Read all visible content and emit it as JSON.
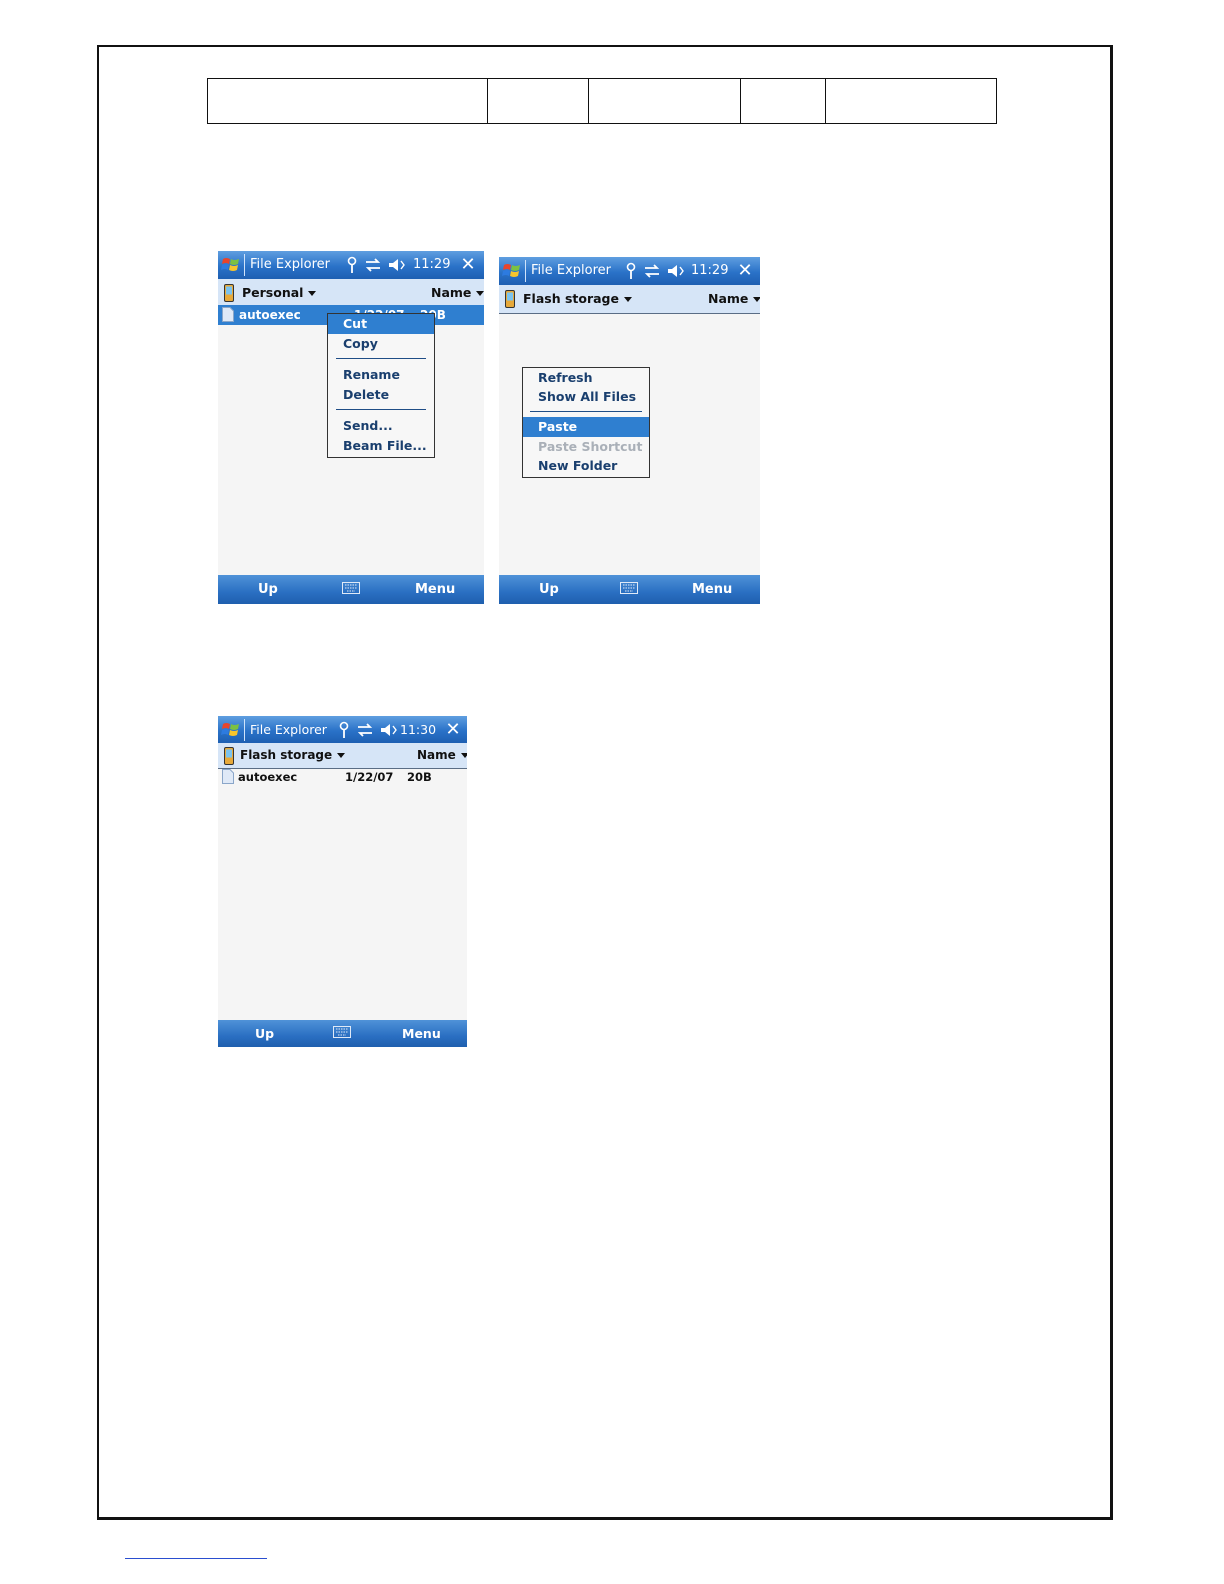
{
  "colors": {
    "titlebar": "#2a72c8",
    "pathbar": "#d6e5f7",
    "selection": "#2f7fd0",
    "menu_text": "#1a3f6e",
    "disabled_text": "#aab0b8"
  },
  "screens": [
    {
      "title": "File Explorer",
      "time": "11:29",
      "folder": "Personal",
      "sort": "Name",
      "file": {
        "name": "autoexec",
        "date": "1/22/07",
        "size": "20B",
        "selected": true
      },
      "context_menu": [
        "Cut",
        "Copy",
        "Rename",
        "Delete",
        "Send...",
        "Beam File..."
      ],
      "softkeys": {
        "left": "Up",
        "right": "Menu"
      }
    },
    {
      "title": "File Explorer",
      "time": "11:29",
      "folder": "Flash storage",
      "sort": "Name",
      "context_menu": [
        "Refresh",
        "Show All Files",
        "Paste",
        "Paste Shortcut",
        "New Folder"
      ],
      "softkeys": {
        "left": "Up",
        "right": "Menu"
      }
    },
    {
      "title": "File Explorer",
      "time": "11:30",
      "folder": "Flash storage",
      "sort": "Name",
      "file": {
        "name": "autoexec",
        "date": "1/22/07",
        "size": "20B",
        "selected": false
      },
      "softkeys": {
        "left": "Up",
        "right": "Menu"
      }
    }
  ],
  "icons": [
    "windows-start-icon",
    "signal-icon",
    "connectivity-icon",
    "speaker-icon",
    "close-icon",
    "device-icon",
    "file-icon",
    "keyboard-icon"
  ]
}
